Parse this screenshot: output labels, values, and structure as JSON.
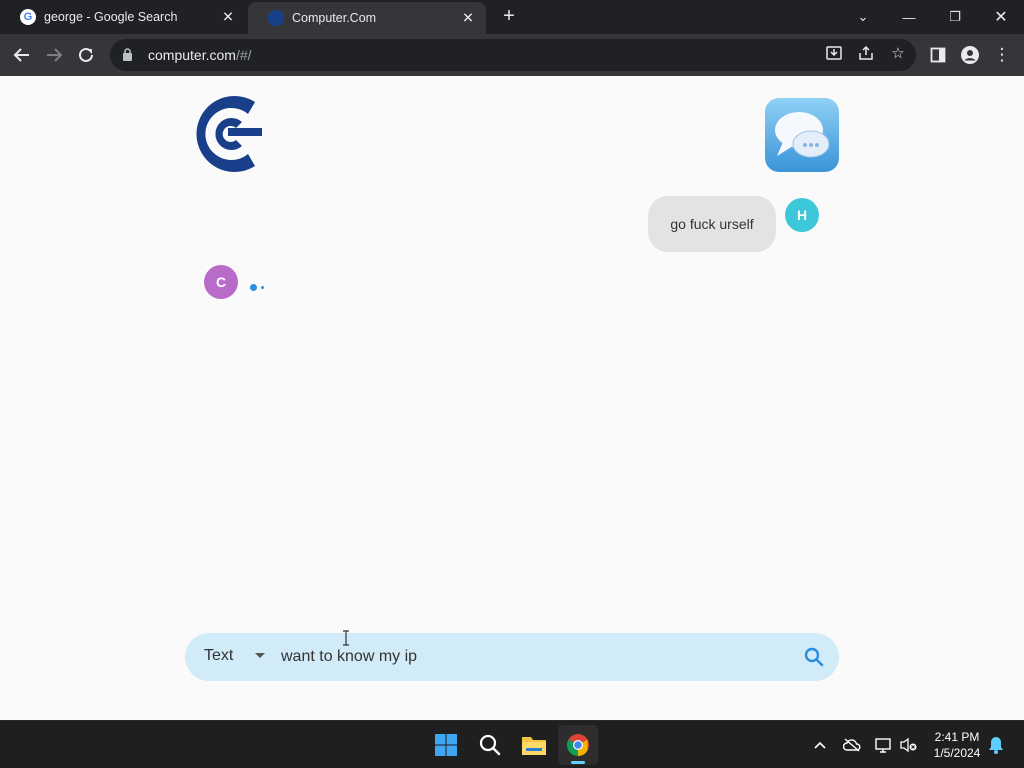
{
  "browser": {
    "tabs": [
      {
        "title": "george - Google Search",
        "favicon": "google-icon",
        "active": false
      },
      {
        "title": "Computer.Com",
        "favicon": "computer-com-icon",
        "active": true
      }
    ],
    "address_bar": {
      "url_host": "computer.com",
      "url_path": "/#/"
    }
  },
  "chat": {
    "messages": [
      {
        "sender": "user",
        "avatar_letter": "H",
        "text": "go fuck urself",
        "avatar_color": "#3cc8d8"
      },
      {
        "sender": "computer",
        "avatar_letter": "C",
        "text": "",
        "typing": true,
        "avatar_color": "#b86bc9"
      }
    ],
    "input": {
      "mode": "Text",
      "value": "want to know my ip"
    }
  },
  "taskbar": {
    "apps": [
      "windows-start-icon",
      "search-icon",
      "file-explorer-icon",
      "chrome-icon"
    ],
    "clock": {
      "time": "2:41 PM",
      "date": "1/5/2024"
    }
  },
  "colors": {
    "accent": "#2a8fe0",
    "input_bg": "#d2ebf8",
    "logo_blue": "#1a3f8a"
  }
}
